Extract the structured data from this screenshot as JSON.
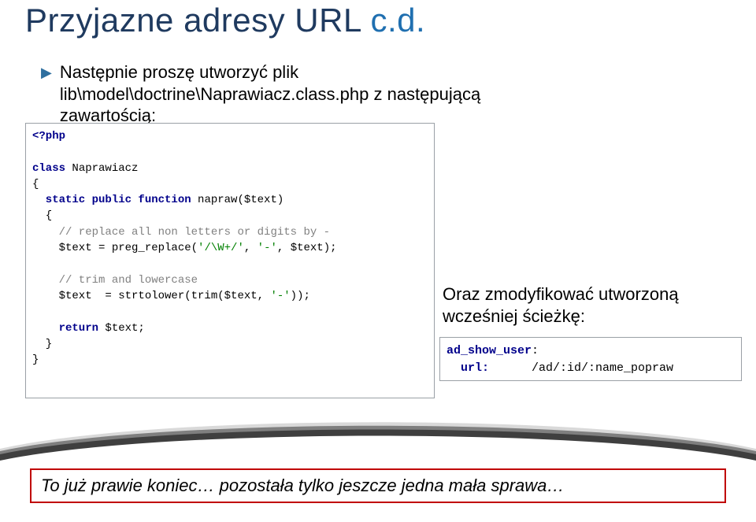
{
  "title_part1": "Przyjazne adresy URL ",
  "title_part2": "c.d.",
  "bullet_text": "Następnie proszę utworzyć plik\nlib\\model\\doctrine\\Naprawiacz.class.php z następującą\nzawartością:",
  "code1": {
    "l1": "<?php",
    "l2a": "class",
    "l2b": " Naprawiacz",
    "l3": "{",
    "l4a": "  static public function",
    "l4b": " napraw($text)",
    "l5": "  {",
    "l6": "    // replace all non letters or digits by -",
    "l7a": "    $text = preg_replace(",
    "l7b": "'/\\W+/'",
    "l7c": ", ",
    "l7d": "'-'",
    "l7e": ", $text);",
    "l8": "    // trim and lowercase",
    "l9a": "    $text  = strtolower(trim($text, ",
    "l9b": "'-'",
    "l9c": "));",
    "l10a": "    return",
    "l10b": " $text;",
    "l11": "  }",
    "l12": "}"
  },
  "intro2": "Oraz zmodyfikować utworzoną wcześniej ścieżkę:",
  "code2": {
    "l1a": "ad_show_user",
    "l1b": ":",
    "l2a": "  url:",
    "l2b": "      /ad/:id/:name_popraw"
  },
  "callout": "To już prawie koniec… pozostała tylko jeszcze jedna mała sprawa…"
}
